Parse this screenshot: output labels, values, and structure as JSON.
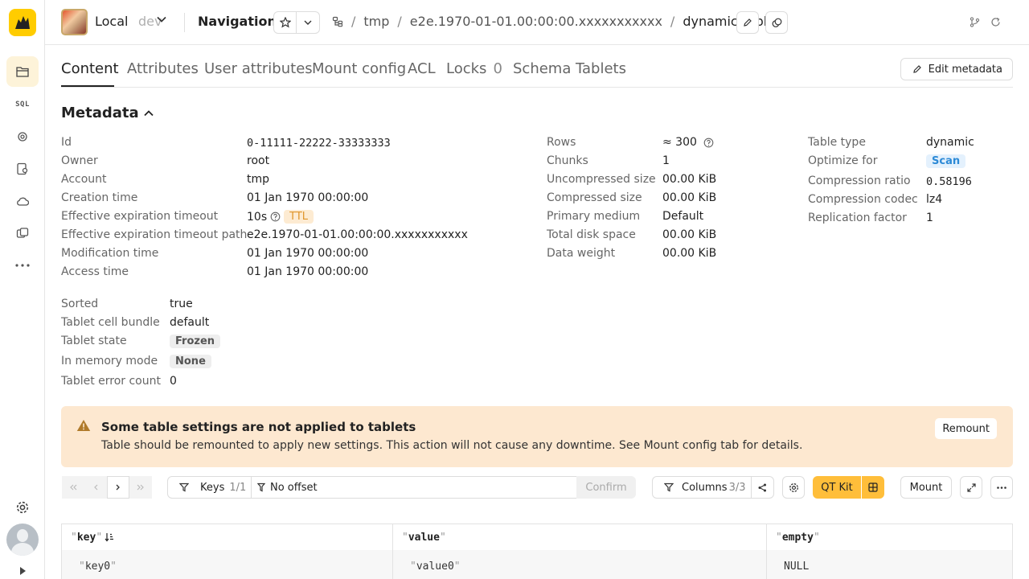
{
  "header": {
    "cluster_name": "Local",
    "cluster_env": "dev",
    "page_name": "Navigation",
    "breadcrumbs": [
      {
        "label": "tmp"
      },
      {
        "label": "e2e.1970-01-01.00:00:00.xxxxxxxxxxx"
      },
      {
        "label": "dynamic-table"
      }
    ]
  },
  "sidebar": {
    "sql_label": "SQL"
  },
  "tabs": [
    {
      "label": "Content"
    },
    {
      "label": "Attributes"
    },
    {
      "label": "User attributes"
    },
    {
      "label": "Mount config"
    },
    {
      "label": "ACL"
    },
    {
      "label": "Locks",
      "count": "0"
    },
    {
      "label": "Schema"
    },
    {
      "label": "Tablets"
    }
  ],
  "edit_metadata_label": "Edit metadata",
  "metadata": {
    "title": "Metadata",
    "col1": [
      {
        "key": "Id",
        "value": "0-11111-22222-33333333"
      },
      {
        "key": "Owner",
        "value": "root"
      },
      {
        "key": "Account",
        "value": "tmp"
      },
      {
        "key": "Creation time",
        "value": "01 Jan 1970 00:00:00"
      },
      {
        "key": "Effective expiration timeout",
        "value": "10s",
        "badge": "TTL"
      },
      {
        "key": "Effective expiration timeout path",
        "value": "e2e.1970-01-01.00:00:00.xxxxxxxxxxx"
      },
      {
        "key": "Modification time",
        "value": "01 Jan 1970 00:00:00"
      },
      {
        "key": "Access time",
        "value": "01 Jan 1970 00:00:00"
      }
    ],
    "col2": [
      {
        "key": "Rows",
        "value": "≈ 300"
      },
      {
        "key": "Chunks",
        "value": "1"
      },
      {
        "key": "Uncompressed size",
        "value": "00.00 KiB"
      },
      {
        "key": "Compressed size",
        "value": "00.00 KiB"
      },
      {
        "key": "Primary medium",
        "value": "Default"
      },
      {
        "key": "Total disk space",
        "value": "00.00 KiB"
      },
      {
        "key": "Data weight",
        "value": "00.00 KiB"
      }
    ],
    "col3": [
      {
        "key": "Table type",
        "value": "dynamic"
      },
      {
        "key": "Optimize for",
        "value": "Scan"
      },
      {
        "key": "Compression ratio",
        "value": "0.58196"
      },
      {
        "key": "Compression codec",
        "value": "lz4"
      },
      {
        "key": "Replication factor",
        "value": "1"
      }
    ],
    "tablet": [
      {
        "key": "Sorted",
        "value": "true"
      },
      {
        "key": "Tablet cell bundle",
        "value": "default"
      },
      {
        "key": "Tablet state",
        "value": "Frozen"
      },
      {
        "key": "In memory mode",
        "value": "None"
      },
      {
        "key": "Tablet error count",
        "value": "0"
      }
    ]
  },
  "warning": {
    "title": "Some table settings are not applied to tablets",
    "text": "Table should be remounted to apply new settings. This action will not cause any downtime. See Mount config tab for details.",
    "button": "Remount"
  },
  "toolbar": {
    "keys_label": "Keys",
    "keys_count": "1/1",
    "offset_placeholder": "No offset",
    "confirm_label": "Confirm",
    "columns_label": "Columns",
    "columns_count": "3/3",
    "qt_kit_label": "QT Kit",
    "mount_label": "Mount"
  },
  "table": {
    "columns": [
      "key",
      "value",
      "empty"
    ],
    "rows": [
      [
        "key0",
        "value0",
        "NULL"
      ]
    ]
  },
  "colors": {
    "accent": "#ffcc00",
    "warning_bg": "#fde8d0",
    "qt_kit": "#ffbe3a"
  }
}
